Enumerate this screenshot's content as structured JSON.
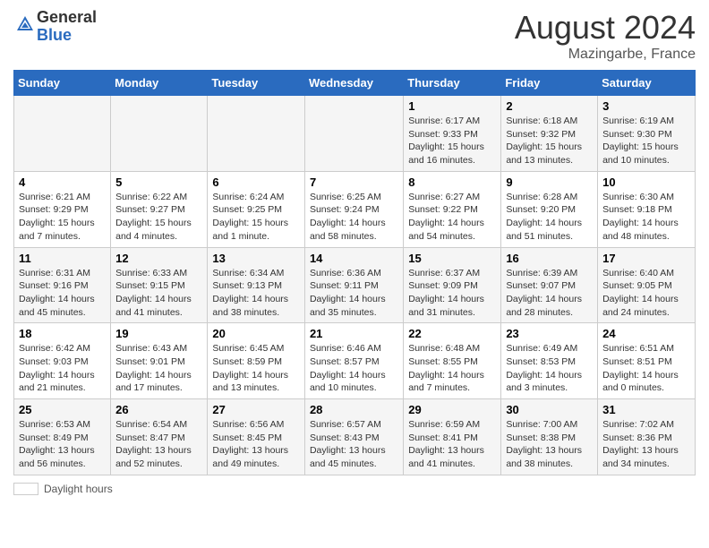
{
  "header": {
    "logo_general": "General",
    "logo_blue": "Blue",
    "month_year": "August 2024",
    "location": "Mazingarbe, France"
  },
  "weekdays": [
    "Sunday",
    "Monday",
    "Tuesday",
    "Wednesday",
    "Thursday",
    "Friday",
    "Saturday"
  ],
  "footer": {
    "label": "Daylight hours"
  },
  "weeks": [
    [
      {
        "day": "",
        "info": ""
      },
      {
        "day": "",
        "info": ""
      },
      {
        "day": "",
        "info": ""
      },
      {
        "day": "",
        "info": ""
      },
      {
        "day": "1",
        "info": "Sunrise: 6:17 AM\nSunset: 9:33 PM\nDaylight: 15 hours and 16 minutes."
      },
      {
        "day": "2",
        "info": "Sunrise: 6:18 AM\nSunset: 9:32 PM\nDaylight: 15 hours and 13 minutes."
      },
      {
        "day": "3",
        "info": "Sunrise: 6:19 AM\nSunset: 9:30 PM\nDaylight: 15 hours and 10 minutes."
      }
    ],
    [
      {
        "day": "4",
        "info": "Sunrise: 6:21 AM\nSunset: 9:29 PM\nDaylight: 15 hours and 7 minutes."
      },
      {
        "day": "5",
        "info": "Sunrise: 6:22 AM\nSunset: 9:27 PM\nDaylight: 15 hours and 4 minutes."
      },
      {
        "day": "6",
        "info": "Sunrise: 6:24 AM\nSunset: 9:25 PM\nDaylight: 15 hours and 1 minute."
      },
      {
        "day": "7",
        "info": "Sunrise: 6:25 AM\nSunset: 9:24 PM\nDaylight: 14 hours and 58 minutes."
      },
      {
        "day": "8",
        "info": "Sunrise: 6:27 AM\nSunset: 9:22 PM\nDaylight: 14 hours and 54 minutes."
      },
      {
        "day": "9",
        "info": "Sunrise: 6:28 AM\nSunset: 9:20 PM\nDaylight: 14 hours and 51 minutes."
      },
      {
        "day": "10",
        "info": "Sunrise: 6:30 AM\nSunset: 9:18 PM\nDaylight: 14 hours and 48 minutes."
      }
    ],
    [
      {
        "day": "11",
        "info": "Sunrise: 6:31 AM\nSunset: 9:16 PM\nDaylight: 14 hours and 45 minutes."
      },
      {
        "day": "12",
        "info": "Sunrise: 6:33 AM\nSunset: 9:15 PM\nDaylight: 14 hours and 41 minutes."
      },
      {
        "day": "13",
        "info": "Sunrise: 6:34 AM\nSunset: 9:13 PM\nDaylight: 14 hours and 38 minutes."
      },
      {
        "day": "14",
        "info": "Sunrise: 6:36 AM\nSunset: 9:11 PM\nDaylight: 14 hours and 35 minutes."
      },
      {
        "day": "15",
        "info": "Sunrise: 6:37 AM\nSunset: 9:09 PM\nDaylight: 14 hours and 31 minutes."
      },
      {
        "day": "16",
        "info": "Sunrise: 6:39 AM\nSunset: 9:07 PM\nDaylight: 14 hours and 28 minutes."
      },
      {
        "day": "17",
        "info": "Sunrise: 6:40 AM\nSunset: 9:05 PM\nDaylight: 14 hours and 24 minutes."
      }
    ],
    [
      {
        "day": "18",
        "info": "Sunrise: 6:42 AM\nSunset: 9:03 PM\nDaylight: 14 hours and 21 minutes."
      },
      {
        "day": "19",
        "info": "Sunrise: 6:43 AM\nSunset: 9:01 PM\nDaylight: 14 hours and 17 minutes."
      },
      {
        "day": "20",
        "info": "Sunrise: 6:45 AM\nSunset: 8:59 PM\nDaylight: 14 hours and 13 minutes."
      },
      {
        "day": "21",
        "info": "Sunrise: 6:46 AM\nSunset: 8:57 PM\nDaylight: 14 hours and 10 minutes."
      },
      {
        "day": "22",
        "info": "Sunrise: 6:48 AM\nSunset: 8:55 PM\nDaylight: 14 hours and 7 minutes."
      },
      {
        "day": "23",
        "info": "Sunrise: 6:49 AM\nSunset: 8:53 PM\nDaylight: 14 hours and 3 minutes."
      },
      {
        "day": "24",
        "info": "Sunrise: 6:51 AM\nSunset: 8:51 PM\nDaylight: 14 hours and 0 minutes."
      }
    ],
    [
      {
        "day": "25",
        "info": "Sunrise: 6:53 AM\nSunset: 8:49 PM\nDaylight: 13 hours and 56 minutes."
      },
      {
        "day": "26",
        "info": "Sunrise: 6:54 AM\nSunset: 8:47 PM\nDaylight: 13 hours and 52 minutes."
      },
      {
        "day": "27",
        "info": "Sunrise: 6:56 AM\nSunset: 8:45 PM\nDaylight: 13 hours and 49 minutes."
      },
      {
        "day": "28",
        "info": "Sunrise: 6:57 AM\nSunset: 8:43 PM\nDaylight: 13 hours and 45 minutes."
      },
      {
        "day": "29",
        "info": "Sunrise: 6:59 AM\nSunset: 8:41 PM\nDaylight: 13 hours and 41 minutes."
      },
      {
        "day": "30",
        "info": "Sunrise: 7:00 AM\nSunset: 8:38 PM\nDaylight: 13 hours and 38 minutes."
      },
      {
        "day": "31",
        "info": "Sunrise: 7:02 AM\nSunset: 8:36 PM\nDaylight: 13 hours and 34 minutes."
      }
    ]
  ]
}
